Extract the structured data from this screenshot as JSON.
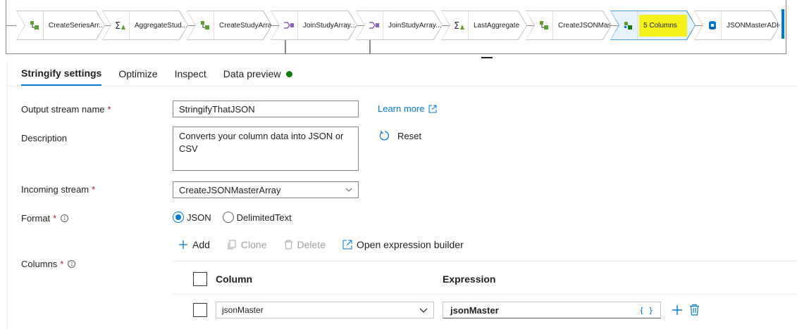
{
  "pipeline": {
    "nodes": [
      {
        "label": "CreateSeriesArr...",
        "icon": "derived-column-icon"
      },
      {
        "label": "AggregateStud...",
        "icon": "aggregate-icon"
      },
      {
        "label": "CreateStudyArray",
        "icon": "derived-column-icon"
      },
      {
        "label": "JoinStudyArray...",
        "icon": "join-icon"
      },
      {
        "label": "JoinStudyArray...",
        "icon": "join-icon"
      },
      {
        "label": "LastAggregate",
        "icon": "aggregate-icon"
      },
      {
        "label": "CreateJSONMas...",
        "icon": "derived-column-icon"
      },
      {
        "label": "5 Columns",
        "icon": "stringify-icon",
        "selected": true,
        "highlight": "#f6f01c"
      },
      {
        "label": "JSONMasterADF",
        "icon": "sink-icon"
      }
    ]
  },
  "tabs": [
    {
      "label": "Stringify settings",
      "active": true
    },
    {
      "label": "Optimize"
    },
    {
      "label": "Inspect"
    },
    {
      "label": "Data preview",
      "status": "ready"
    }
  ],
  "form": {
    "output_stream": {
      "label": "Output stream name",
      "required": "*",
      "value": "StringifyThatJSON"
    },
    "learn_more": "Learn more",
    "description": {
      "label": "Description",
      "value": "Converts your column data into JSON or CSV"
    },
    "reset": "Reset",
    "incoming_stream": {
      "label": "Incoming stream",
      "required": "*",
      "value": "CreateJSONMasterArray"
    },
    "format": {
      "label": "Format",
      "required": "*",
      "options": [
        "JSON",
        "DelimitedText"
      ],
      "selected": "JSON"
    },
    "toolbar": {
      "add": "Add",
      "clone": "Clone",
      "delete": "Delete",
      "open_builder": "Open expression builder"
    },
    "columns": {
      "label": "Columns",
      "required": "*",
      "headers": {
        "column": "Column",
        "expression": "Expression"
      },
      "rows": [
        {
          "column": "jsonMaster",
          "expression": "jsonMaster",
          "expr_icon": "{ }"
        }
      ]
    }
  },
  "colors": {
    "accent": "#0078d4",
    "highlight": "#f6f01c",
    "status_dot": "#107c10",
    "required": "#a4262c"
  }
}
